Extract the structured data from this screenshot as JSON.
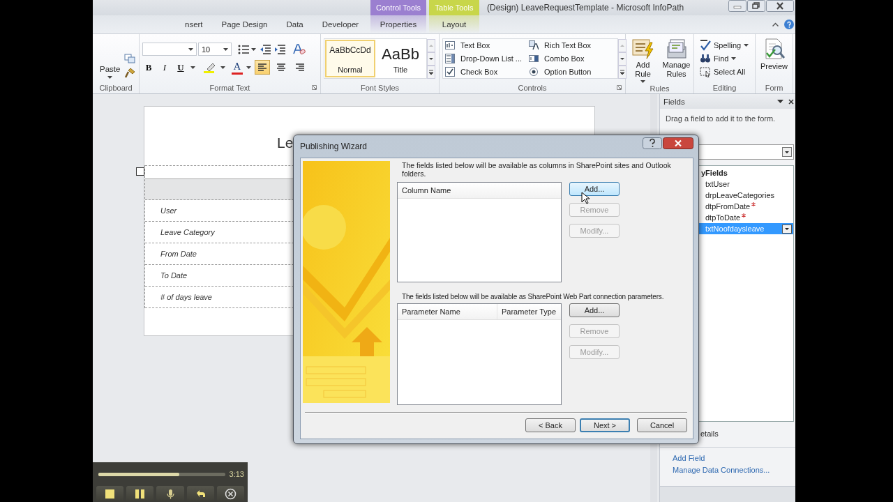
{
  "window": {
    "title": "(Design) LeaveRequestTemplate  -  Microsoft InfoPath",
    "context_tabs": [
      {
        "label": "Control Tools",
        "color": "#9b7fd0",
        "tab": "Properties"
      },
      {
        "label": "Table Tools",
        "color": "#c8d64a",
        "tab": "Layout"
      }
    ]
  },
  "ribbon_tabs": [
    "nsert",
    "Page Design",
    "Data",
    "Developer"
  ],
  "ribbon": {
    "clipboard": {
      "label": "Clipboard",
      "paste": "Paste"
    },
    "format_text": {
      "label": "Format Text",
      "font_size": "10",
      "format_buttons": [
        {
          "kind": "bold",
          "label": "B"
        },
        {
          "kind": "italic",
          "label": "I"
        },
        {
          "kind": "underline",
          "label": "U"
        }
      ],
      "font_color": "A",
      "alignment": [
        {
          "kind": "left",
          "selected": true
        },
        {
          "kind": "center",
          "selected": false
        },
        {
          "kind": "right",
          "selected": false
        }
      ]
    },
    "font_styles": {
      "label": "Font Styles",
      "styles": [
        {
          "sample": "AaBbCcDd",
          "name": "Normal",
          "selected": true
        },
        {
          "sample": "AaBb",
          "name": "Title",
          "selected": false
        }
      ]
    },
    "controls": {
      "label": "Controls",
      "items": [
        {
          "kind": "textbox",
          "label": "Text Box"
        },
        {
          "kind": "richtext",
          "label": "Rich Text Box"
        },
        {
          "kind": "dropdown",
          "label": "Drop-Down List ..."
        },
        {
          "kind": "combo",
          "label": "Combo Box"
        },
        {
          "kind": "checkbox",
          "label": "Check Box"
        },
        {
          "kind": "option",
          "label": "Option Button"
        }
      ]
    },
    "rules": {
      "label": "Rules",
      "buttons": [
        {
          "kind": "add",
          "label": "Add Rule",
          "menu": true
        },
        {
          "kind": "manage",
          "label": "Manage Rules",
          "menu": false
        }
      ]
    },
    "editing": {
      "label": "Editing",
      "items": [
        {
          "kind": "spelling",
          "label": "Spelling",
          "menu": true
        },
        {
          "kind": "find",
          "label": "Find",
          "menu": true
        },
        {
          "kind": "select",
          "label": "Select All",
          "menu": false
        }
      ]
    },
    "form": {
      "label": "Form",
      "preview": "Preview"
    }
  },
  "form_view": {
    "title": "Le",
    "rows": [
      "User",
      "Leave Category",
      "From Date",
      "To Date",
      "# of days leave"
    ]
  },
  "fields_pane": {
    "title": "Fields",
    "hint": "Drag a field to add it to the form.",
    "root": {
      "label": "yFields",
      "children": [
        {
          "label": "txtUser",
          "required": false,
          "selected": false
        },
        {
          "label": "drpLeaveCategories",
          "required": false,
          "selected": false
        },
        {
          "label": "dtpFromDate",
          "required": true,
          "selected": false
        },
        {
          "label": "dtpToDate",
          "required": true,
          "selected": false
        },
        {
          "label": "txtNoofdaysleave",
          "required": false,
          "selected": true
        }
      ]
    },
    "details": "etails",
    "links": [
      "Add Field",
      "Manage Data Connections..."
    ]
  },
  "dialog": {
    "title": "Publishing Wizard",
    "columns_text": "The fields listed below will be available as columns in SharePoint sites and Outlook folders.",
    "columns_headers": [
      "Column Name"
    ],
    "columns_buttons": [
      {
        "label": "Add...",
        "disabled": false,
        "hovered": true
      },
      {
        "label": "Remove",
        "disabled": true,
        "hovered": false
      },
      {
        "label": "Modify...",
        "disabled": true,
        "hovered": false
      }
    ],
    "params_text": "The fields listed below will be available as SharePoint Web Part connection parameters.",
    "params_headers": [
      "Parameter Name",
      "Parameter Type"
    ],
    "params_buttons": [
      {
        "label": "Add...",
        "disabled": false,
        "hovered": false
      },
      {
        "label": "Remove",
        "disabled": true,
        "hovered": false
      },
      {
        "label": "Modify...",
        "disabled": true,
        "hovered": false
      }
    ],
    "nav_buttons": [
      {
        "label": "< Back",
        "default": false
      },
      {
        "label": "Next >",
        "default": true
      },
      {
        "label": "Cancel",
        "default": false
      }
    ]
  },
  "player": {
    "level": 0.64,
    "time": "3:13"
  }
}
